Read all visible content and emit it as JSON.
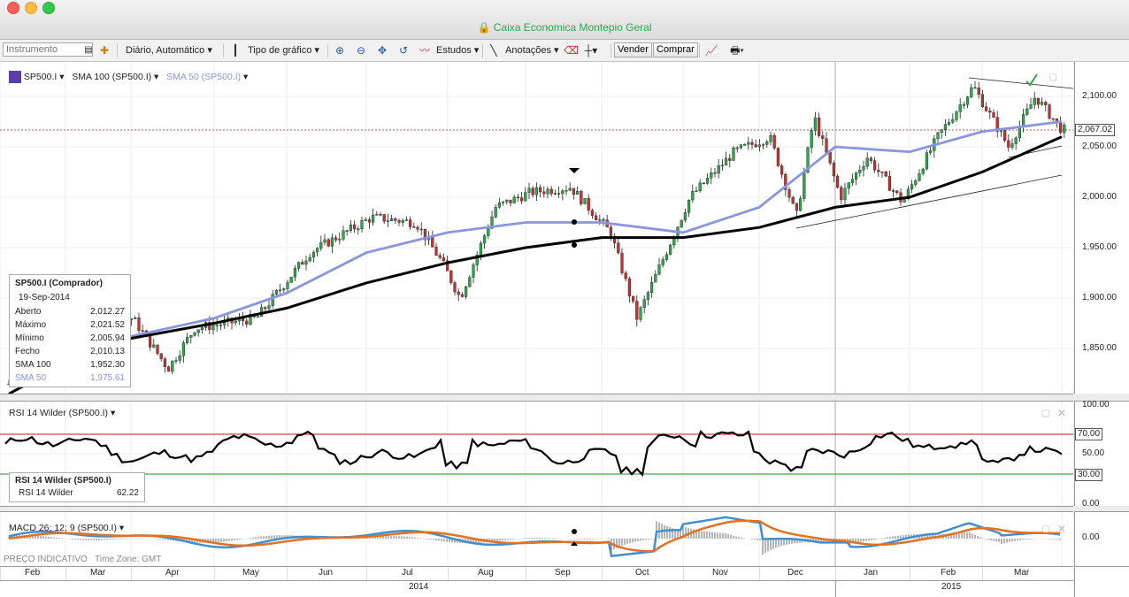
{
  "window": {
    "title": "Caixa Economica Montepio Geral"
  },
  "toolbar": {
    "instrument_placeholder": "Instrumento",
    "period_label": "Diário, Automático",
    "chart_type_label": "Tipo de gráfico",
    "studies_label": "Estudos",
    "annotations_label": "Anotações",
    "sell_label": "Vender",
    "buy_label": "Comprar"
  },
  "main_legend": {
    "symbol": "SP500.I",
    "sma100": "SMA 100 (SP500.I)",
    "sma50": "SMA 50 (SP500.I)"
  },
  "info": {
    "title": "SP500.I (Comprador)",
    "date": "19-Sep-2014",
    "rows": [
      {
        "label": "Aberto",
        "value": "2,012.27"
      },
      {
        "label": "Máximo",
        "value": "2,021.52"
      },
      {
        "label": "Mínimo",
        "value": "2,005.94"
      },
      {
        "label": "Fecho",
        "value": "2,010.13"
      },
      {
        "label": "SMA 100",
        "value": "1,952.30"
      },
      {
        "label": "SMA 50",
        "value": "1,975.61"
      }
    ]
  },
  "price_axis": {
    "ticks": [
      "2,100.00",
      "2,050.00",
      "2,000.00",
      "1,950.00",
      "1,900.00",
      "1,850.00"
    ],
    "current": "2,067.02"
  },
  "rsi": {
    "legend": "RSI 14 Wilder (SP500.I)",
    "box_title": "RSI 14 Wilder (SP500.I)",
    "box_label": "RSI 14 Wilder",
    "box_value": "62.22",
    "ticks": [
      "100.00",
      "70.00",
      "50.00",
      "30.00",
      "0.00"
    ]
  },
  "macd": {
    "legend": "MACD 26; 12; 9 (SP500.I)",
    "tick": "0.00"
  },
  "footer": {
    "indicative": "PREÇO INDICATIVO",
    "timezone": "Time Zone: GMT"
  },
  "months": [
    "Feb",
    "Mar",
    "Apr",
    "May",
    "Jun",
    "Jul",
    "Aug",
    "Sep",
    "Oct",
    "Nov",
    "Dec",
    "Jan",
    "Feb",
    "Mar"
  ],
  "years": [
    "2014",
    "2015"
  ],
  "colors": {
    "sma100": "#000000",
    "sma50": "#8896e0",
    "rsi_upper": "#d01010",
    "rsi_lower": "#2a8a2a",
    "macd": "#3f8fd0",
    "signal": "#e6701e"
  },
  "chart_data": {
    "type": "line",
    "series": [
      {
        "name": "SMA 100 (SP500.I)",
        "values": [
          1805,
          1835,
          1860,
          1875,
          1890,
          1915,
          1935,
          1950,
          1960,
          1960,
          1970,
          1990,
          2000,
          2025,
          2060
        ]
      },
      {
        "name": "SMA 50 (SP500.I)",
        "values": [
          1815,
          1845,
          1862,
          1880,
          1905,
          1945,
          1965,
          1975,
          1975,
          1965,
          1990,
          2050,
          2045,
          2065,
          2075
        ]
      }
    ],
    "x": [
      "Feb",
      "Mar",
      "Apr",
      "May",
      "Jun",
      "Jul",
      "Aug",
      "Sep",
      "Oct",
      "Nov",
      "Dec",
      "Jan",
      "Feb",
      "Mar"
    ],
    "ylim": [
      1800,
      2120
    ]
  }
}
